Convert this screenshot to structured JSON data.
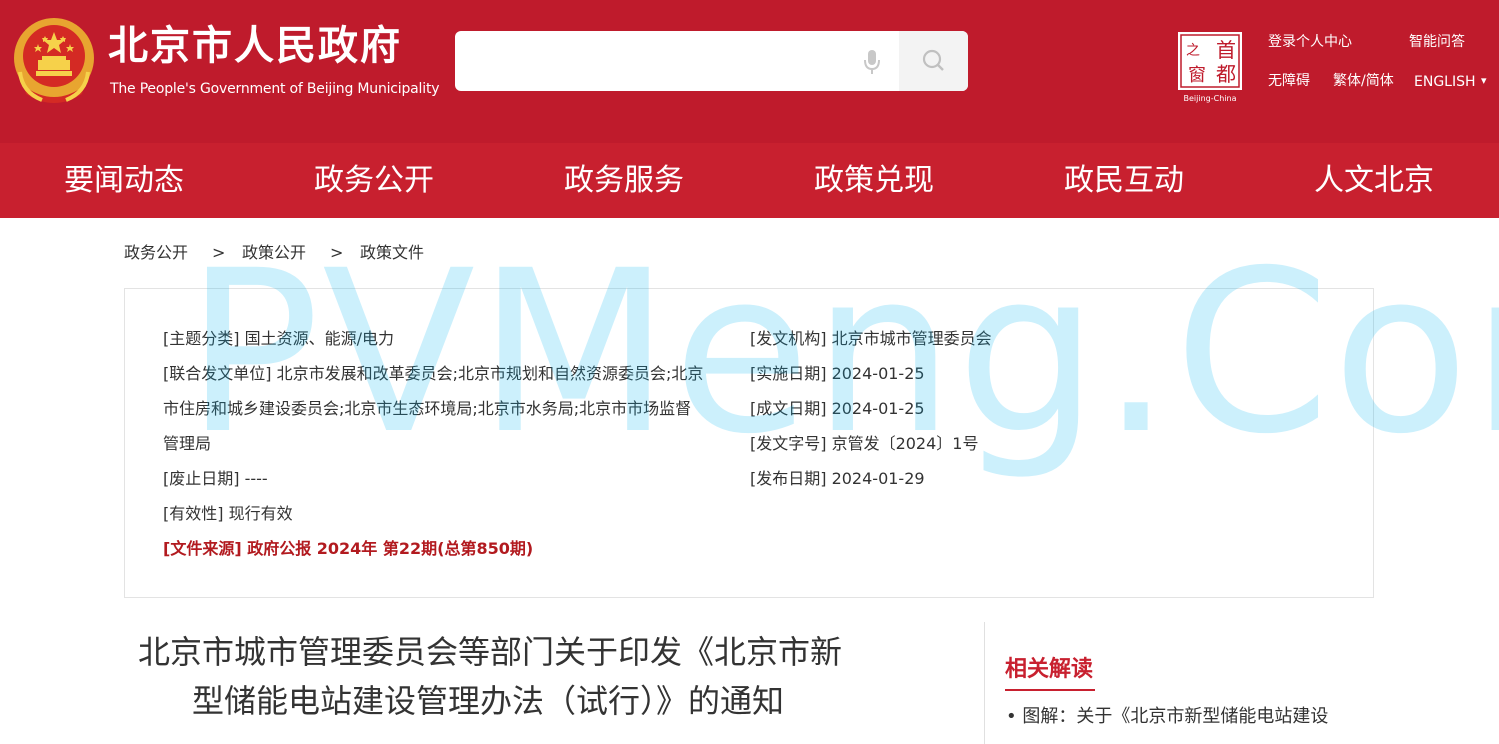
{
  "header": {
    "title": "北京市人民政府",
    "subtitle": "The People's Government of Beijing Municipality",
    "search": {
      "placeholder": ""
    },
    "logo_text": {
      "c1": "首",
      "c2": "之",
      "c3": "都",
      "c4": "窗",
      "caption": "Beijing-China"
    },
    "links": {
      "login": "登录个人中心",
      "qa": "智能问答",
      "accessible": "无障碍",
      "traditional": "繁体/简体",
      "english": "ENGLISH",
      "english_arrow": "▾"
    }
  },
  "nav": {
    "items": [
      "要闻动态",
      "政务公开",
      "政务服务",
      "政策兑现",
      "政民互动",
      "人文北京"
    ]
  },
  "breadcrumb": {
    "items": [
      "政务公开",
      "政策公开",
      "政策文件"
    ],
    "separator": ">"
  },
  "meta": {
    "topic": "[主题分类] 国土资源、能源/电力",
    "issuer": "[发文机构] 北京市城市管理委员会",
    "joint_line1": "[联合发文单位] 北京市发展和改革委员会;北京市规划和自然资源委员会;北京",
    "joint_line2": "市住房和城乡建设委员会;北京市生态环境局;北京市水务局;北京市市场监督",
    "joint_line3": "管理局",
    "effective_date": "[实施日期] 2024-01-25",
    "created_date": "[成文日期] 2024-01-25",
    "doc_number": "[发文字号] 京管发〔2024〕1号",
    "abolish_date": "[废止日期] ----",
    "publish_date": "[发布日期] 2024-01-29",
    "validity": "[有效性] 现行有效",
    "source": "[文件来源] 政府公报 2024年 第22期(总第850期)"
  },
  "watermark": "PVMeng.Com",
  "article": {
    "title_line1": "北京市城市管理委员会等部门关于印发《北京市新",
    "title_line2": "型储能电站建设管理办法（试行）》的通知"
  },
  "related": {
    "heading": "相关解读",
    "items": [
      "• 图解：关于《北京市新型储能电站建设"
    ]
  },
  "colors": {
    "brand_red": "#bf1b2c",
    "nav_red": "#c8202f",
    "source_red": "#b21a1f",
    "watermark": "#00b2ef"
  }
}
